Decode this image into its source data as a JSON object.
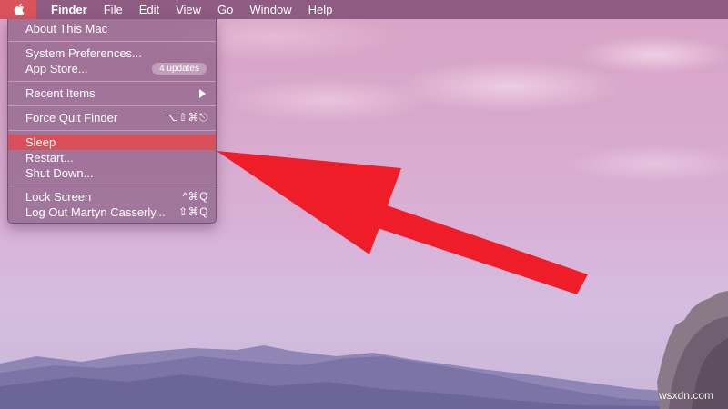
{
  "menubar": {
    "apple_icon": "apple-icon",
    "items": [
      "Finder",
      "File",
      "Edit",
      "View",
      "Go",
      "Window",
      "Help"
    ]
  },
  "apple_menu": {
    "about": "About This Mac",
    "system_preferences": "System Preferences...",
    "app_store": "App Store...",
    "app_store_badge": "4 updates",
    "recent_items": "Recent Items",
    "force_quit": "Force Quit Finder",
    "force_quit_shortcut": "⌥⇧⌘⎋",
    "sleep": "Sleep",
    "restart": "Restart...",
    "shut_down": "Shut Down...",
    "lock_screen": "Lock Screen",
    "lock_screen_shortcut": "^⌘Q",
    "log_out": "Log Out Martyn Casserly...",
    "log_out_shortcut": "⇧⌘Q",
    "highlighted_item": "Sleep"
  },
  "annotation": {
    "arrow_color": "#ee1d27",
    "points_to": "Sleep"
  },
  "watermark": "wsxdn.com",
  "colors": {
    "menubar_bg": "#784670",
    "highlight": "#d8505a",
    "apple_box": "#d9535c"
  }
}
